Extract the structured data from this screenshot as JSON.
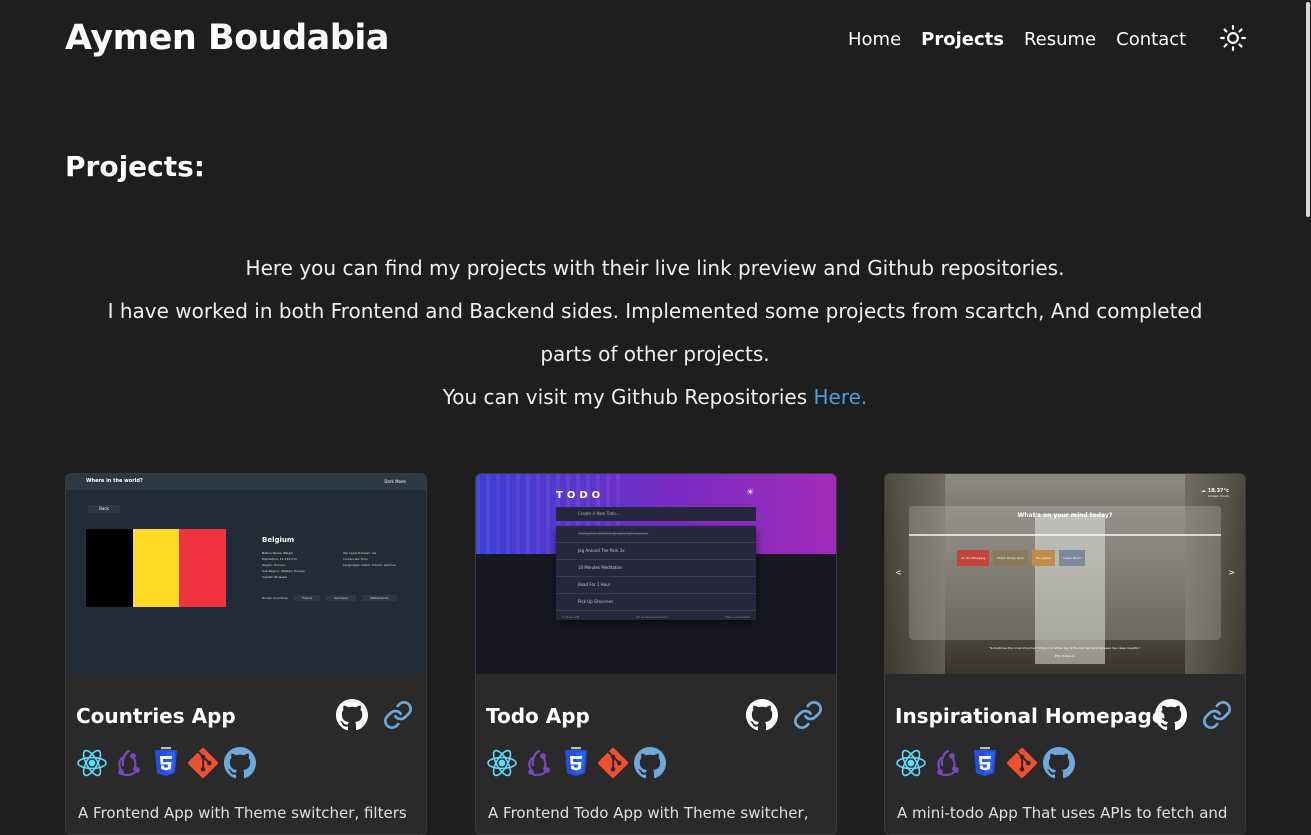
{
  "header": {
    "brand": "Aymen Boudabia",
    "nav": [
      "Home",
      "Projects",
      "Resume",
      "Contact"
    ]
  },
  "page": {
    "title": "Projects:",
    "intro_line1": "Here you can find my projects with their live link preview and Github repositories.",
    "intro_line2": "I have worked in both Frontend and Backend sides. Implemented some projects from scartch, And completed parts of other projects.",
    "intro_line3_prefix": "You can visit my Github Repositories ",
    "intro_link": "Here."
  },
  "projects": [
    {
      "title": "Countries App",
      "description": "A Frontend App with Theme switcher, filters",
      "preview": {
        "header": "Where in the world?",
        "mode": "Dark Mode",
        "back": "Back",
        "country": "Belgium",
        "details_left": [
          "Native Name: België",
          "Population: 11,319,511",
          "Region: Europe",
          "Sub Region: Western Europe",
          "Capital: Brussels"
        ],
        "details_right": [
          "Top Level Domain: .be",
          "Currencies: Euro",
          "Languages: Dutch, French, German"
        ],
        "border_label": "Border Countries:",
        "borders": [
          "France",
          "Germany",
          "Netherlands"
        ]
      }
    },
    {
      "title": "Todo App",
      "description": "A Frontend Todo App with Theme switcher,",
      "preview": {
        "logo": "TODO",
        "placeholder": "Create A New Todo...",
        "items": [
          "Complete Online JavaScript Course",
          "Jog Around The Park 3x",
          "10 Minutes Meditation",
          "Read For 1 Hour",
          "Pick Up Groceries"
        ],
        "footer_left": "5 items left",
        "footer_mid": "All   Active   Completed",
        "footer_right": "Clear Completed"
      }
    },
    {
      "title": "Inspirational Homepage",
      "description": "A mini-todo App That uses APIs to fetch and",
      "preview": {
        "temp": "18.37°c",
        "weather": "broken clouds",
        "question": "What's on your mind today?",
        "chips": [
          "Go for Shopping",
          "Finish Home work",
          "Fix Laptop",
          "Clean Room"
        ],
        "quote": "\"Sometimes the most important thing in a whole day is the rest we take between two deep breaths.\"",
        "author": "Etty Hillesum",
        "prev": "<",
        "next": ">"
      }
    }
  ],
  "colors": {
    "background": "#1e1e1e",
    "card": "#2a2a2a",
    "link": "#4a9fdc",
    "react": "#61dafb",
    "redux": "#764abc",
    "css3": "#264de4",
    "git": "#f05032"
  },
  "icons": [
    "sun-icon",
    "github-icon",
    "link-icon",
    "react-icon",
    "redux-icon",
    "css3-icon",
    "git-icon"
  ]
}
